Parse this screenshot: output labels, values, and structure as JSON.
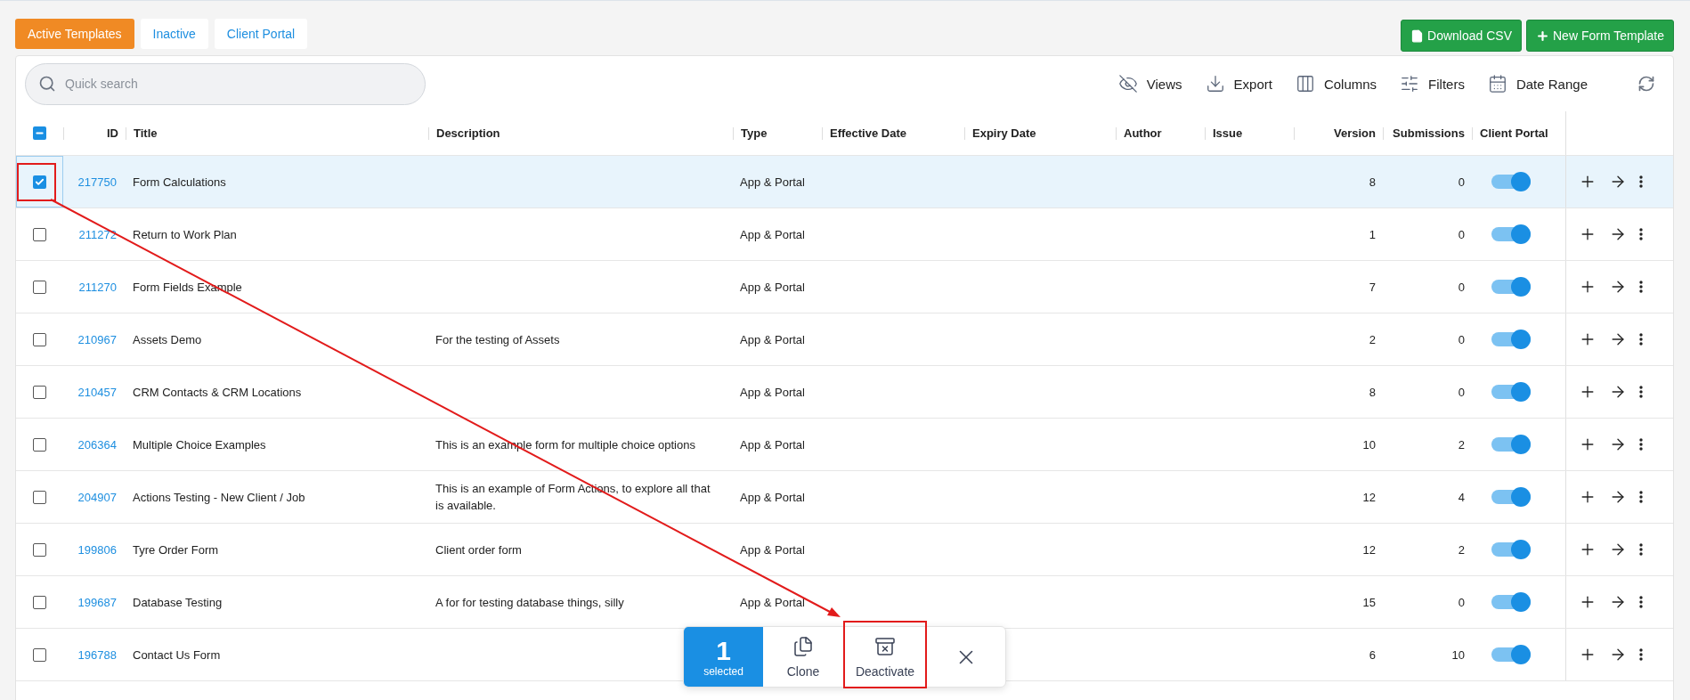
{
  "tabs": [
    {
      "label": "Active Templates",
      "selected": true
    },
    {
      "label": "Inactive",
      "selected": false
    },
    {
      "label": "Client Portal",
      "selected": false
    }
  ],
  "buttons": [
    {
      "kind": "csv",
      "label": "Download CSV"
    },
    {
      "kind": "new",
      "label": "New Form Template"
    }
  ],
  "search": {
    "placeholder": "Quick search"
  },
  "toolbar": [
    {
      "kind": "views",
      "label": "Views"
    },
    {
      "kind": "export",
      "label": "Export"
    },
    {
      "kind": "columns",
      "label": "Columns"
    },
    {
      "kind": "filters",
      "label": "Filters"
    },
    {
      "kind": "date",
      "label": "Date Range"
    },
    {
      "kind": "refresh"
    }
  ],
  "table": {
    "select_all": {
      "indeterminate": true
    },
    "columns": [
      "ID",
      "Title",
      "Description",
      "Type",
      "Effective Date",
      "Expiry Date",
      "Author",
      "Issue",
      "Version",
      "Submissions",
      "Client Portal"
    ],
    "rows": [
      {
        "id": "217750",
        "title": "Form Calculations",
        "description": "",
        "type": "App & Portal",
        "version": "8",
        "submissions": "0",
        "client_portal": true,
        "selected": true
      },
      {
        "id": "211272",
        "title": "Return to Work Plan",
        "description": "",
        "type": "App & Portal",
        "version": "1",
        "submissions": "0",
        "client_portal": true,
        "selected": false
      },
      {
        "id": "211270",
        "title": "Form Fields Example",
        "description": "",
        "type": "App & Portal",
        "version": "7",
        "submissions": "0",
        "client_portal": true,
        "selected": false
      },
      {
        "id": "210967",
        "title": "Assets Demo",
        "description": "For the testing of Assets",
        "type": "App & Portal",
        "version": "2",
        "submissions": "0",
        "client_portal": true,
        "selected": false
      },
      {
        "id": "210457",
        "title": "CRM Contacts & CRM Locations",
        "description": "",
        "type": "App & Portal",
        "version": "8",
        "submissions": "0",
        "client_portal": true,
        "selected": false
      },
      {
        "id": "206364",
        "title": "Multiple Choice Examples",
        "description": "This is an example form for multiple choice options",
        "type": "App & Portal",
        "version": "10",
        "submissions": "2",
        "client_portal": true,
        "selected": false
      },
      {
        "id": "204907",
        "title": "Actions Testing - New Client / Job",
        "description": "This is an example of Form Actions, to explore all that is available.",
        "type": "App & Portal",
        "version": "12",
        "submissions": "4",
        "client_portal": true,
        "selected": false
      },
      {
        "id": "199806",
        "title": "Tyre Order Form",
        "description": "Client order form",
        "type": "App & Portal",
        "version": "12",
        "submissions": "2",
        "client_portal": true,
        "selected": false
      },
      {
        "id": "199687",
        "title": "Database Testing",
        "description": "A for for testing database things, silly",
        "type": "App & Portal",
        "version": "15",
        "submissions": "0",
        "client_portal": true,
        "selected": false
      },
      {
        "id": "196788",
        "title": "Contact Us Form",
        "description": "",
        "type": "",
        "version": "6",
        "submissions": "10",
        "client_portal": true,
        "selected": false
      }
    ]
  },
  "selection_bar": {
    "count": "1",
    "count_label": "selected",
    "actions": [
      {
        "kind": "clone",
        "label": "Clone"
      },
      {
        "kind": "deactivate",
        "label": "Deactivate"
      }
    ]
  }
}
